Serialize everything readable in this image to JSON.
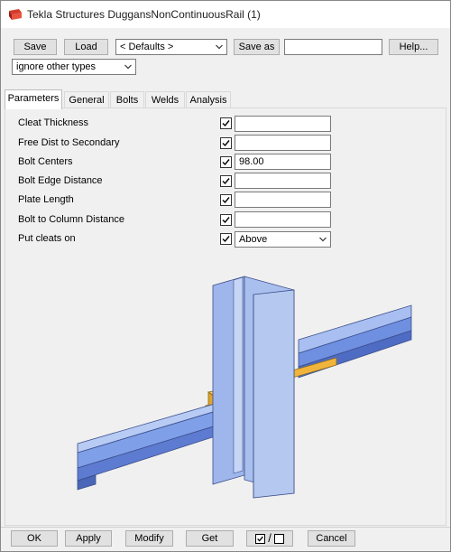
{
  "window": {
    "title": "Tekla Structures  DuggansNonContinuousRail (1)"
  },
  "toolbar": {
    "save_label": "Save",
    "load_label": "Load",
    "defaults_value": "< Defaults >",
    "save_as_label": "Save as",
    "save_as_value": "",
    "help_label": "Help...",
    "filter_value": "ignore other types"
  },
  "tabs": [
    {
      "label": "Parameters",
      "active": true
    },
    {
      "label": "General",
      "active": false
    },
    {
      "label": "Bolts",
      "active": false
    },
    {
      "label": "Welds",
      "active": false
    },
    {
      "label": "Analysis",
      "active": false
    }
  ],
  "parameters": {
    "rows": [
      {
        "label": "Cleat Thickness",
        "checked": true,
        "value": ""
      },
      {
        "label": "Free Dist to Secondary",
        "checked": true,
        "value": ""
      },
      {
        "label": "Bolt Centers",
        "checked": true,
        "value": "98.00"
      },
      {
        "label": "Bolt Edge Distance",
        "checked": true,
        "value": ""
      },
      {
        "label": "Plate Length",
        "checked": true,
        "value": ""
      },
      {
        "label": "Bolt to Column Distance",
        "checked": true,
        "value": ""
      },
      {
        "label": "Put cleats on",
        "checked": true,
        "value": "Above"
      }
    ]
  },
  "footer": {
    "ok_label": "OK",
    "apply_label": "Apply",
    "modify_label": "Modify",
    "get_label": "Get",
    "toggle_separator": "/",
    "cancel_label": "Cancel"
  },
  "colors": {
    "beam_blue": "#7f9fe8",
    "column_blue": "#a9c0ee",
    "cleat_orange": "#f0b43c"
  }
}
